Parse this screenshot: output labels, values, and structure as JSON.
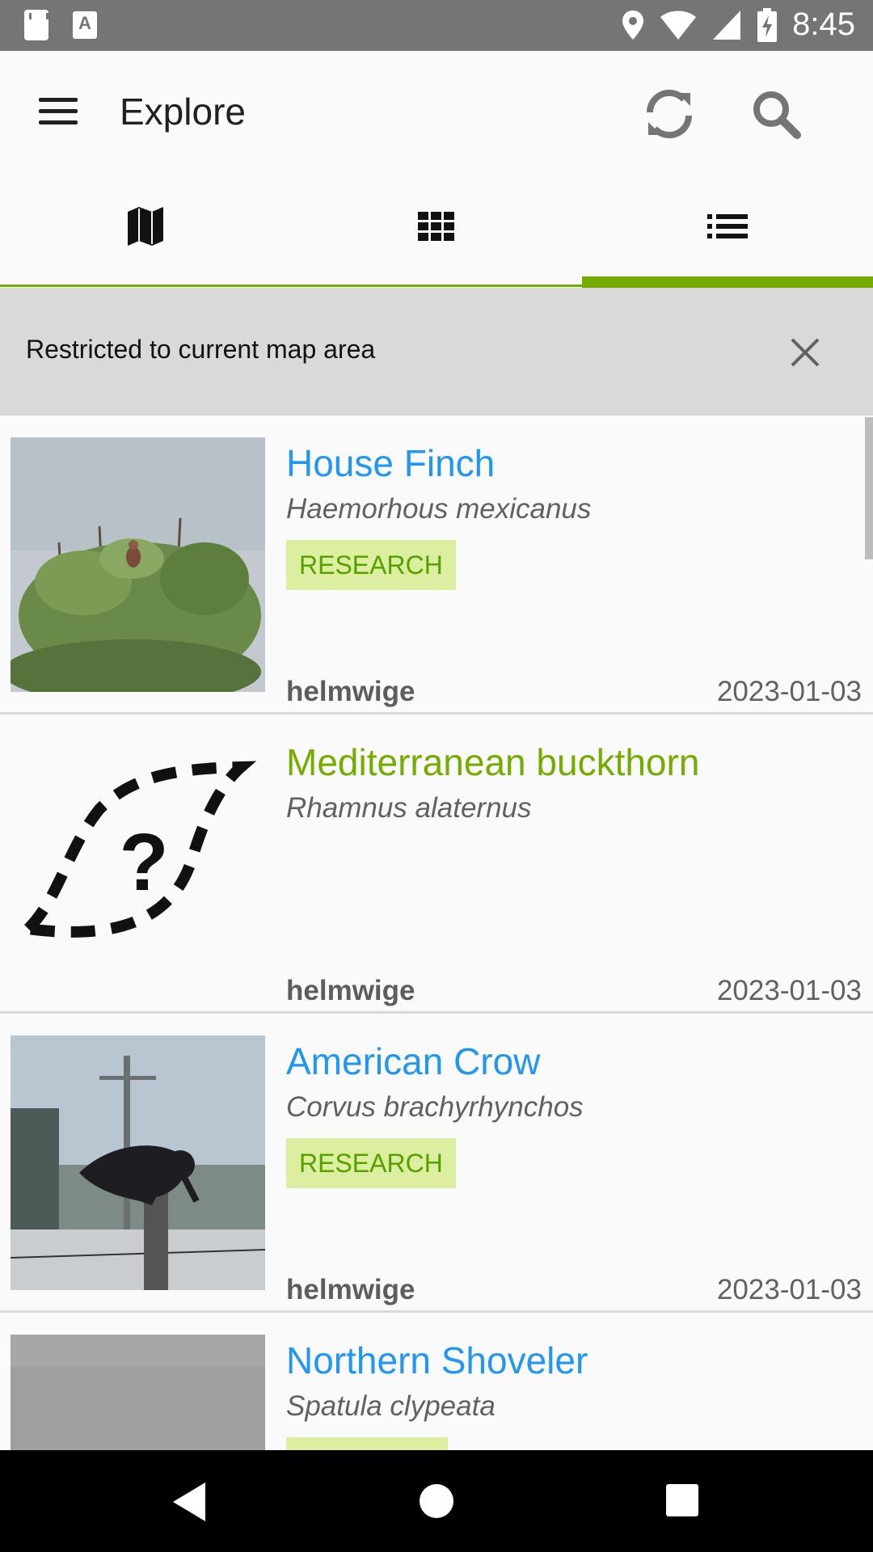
{
  "status_bar": {
    "time": "8:45",
    "icons": [
      "sd-card-icon",
      "a-notification-icon",
      "location-icon",
      "wifi-icon",
      "signal-icon",
      "battery-charging-icon"
    ]
  },
  "app_bar": {
    "title": "Explore",
    "icons": [
      "menu-icon",
      "refresh-icon",
      "search-icon"
    ]
  },
  "tabs": [
    {
      "icon": "map-icon",
      "selected": false
    },
    {
      "icon": "grid-icon",
      "selected": false
    },
    {
      "icon": "list-icon",
      "selected": true
    }
  ],
  "colors": {
    "accent": "#74ac00",
    "link": "#2196f3",
    "badge_bg": "#dcefa0",
    "status_bar": "#757575"
  },
  "banner": {
    "text": "Restricted to current map area"
  },
  "observations": [
    {
      "name": "House Finch",
      "scientific": "Haemorhous mexicanus",
      "badge": "RESEARCH",
      "user": "helmwige",
      "date": "2023-01-03",
      "thumb": "bird-on-shrub-photo"
    },
    {
      "name": "Mediterranean buckthorn",
      "scientific": "Rhamnus alaternus",
      "badge": "",
      "user": "helmwige",
      "date": "2023-01-03",
      "thumb": "unknown-leaf-icon"
    },
    {
      "name": "American Crow",
      "scientific": "Corvus brachyrhynchos",
      "badge": "RESEARCH",
      "user": "helmwige",
      "date": "2023-01-03",
      "thumb": "crow-on-post-photo"
    },
    {
      "name": "Northern Shoveler",
      "scientific": "Spatula clypeata",
      "badge": "",
      "user": "",
      "date": "",
      "thumb": "water-photo"
    }
  ]
}
